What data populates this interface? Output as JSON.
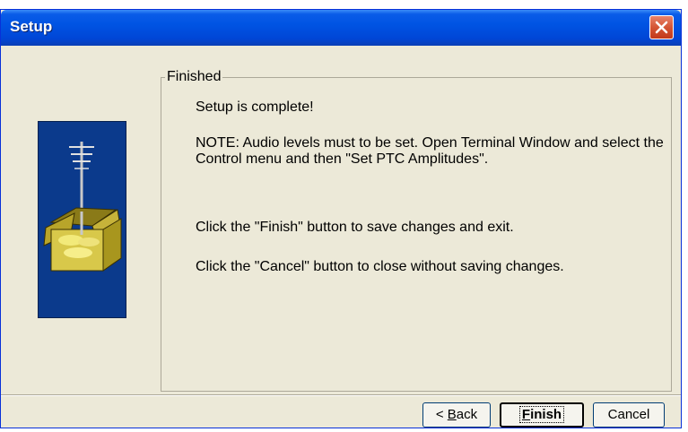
{
  "window": {
    "title": "Setup",
    "close_icon": "close-icon"
  },
  "group": {
    "legend": "Finished"
  },
  "content": {
    "line1": "Setup is complete!",
    "line2": "NOTE: Audio levels must to be set. Open Terminal Window and select the Control menu and then \"Set PTC Amplitudes\".",
    "line3": "Click the \"Finish\" button to save changes and exit.",
    "line4": "Click the \"Cancel\" button to close without saving changes."
  },
  "image": {
    "icon": "setup-box-antenna-icon"
  },
  "buttons": {
    "back_prefix": "< ",
    "back_access": "B",
    "back_rest": "ack",
    "finish_access": "F",
    "finish_rest": "inish",
    "cancel": "Cancel"
  },
  "colors": {
    "titlebar": "#0054e3",
    "dialog_bg": "#ece9d8",
    "side_panel": "#0b3a8c",
    "close_button": "#d45535"
  }
}
